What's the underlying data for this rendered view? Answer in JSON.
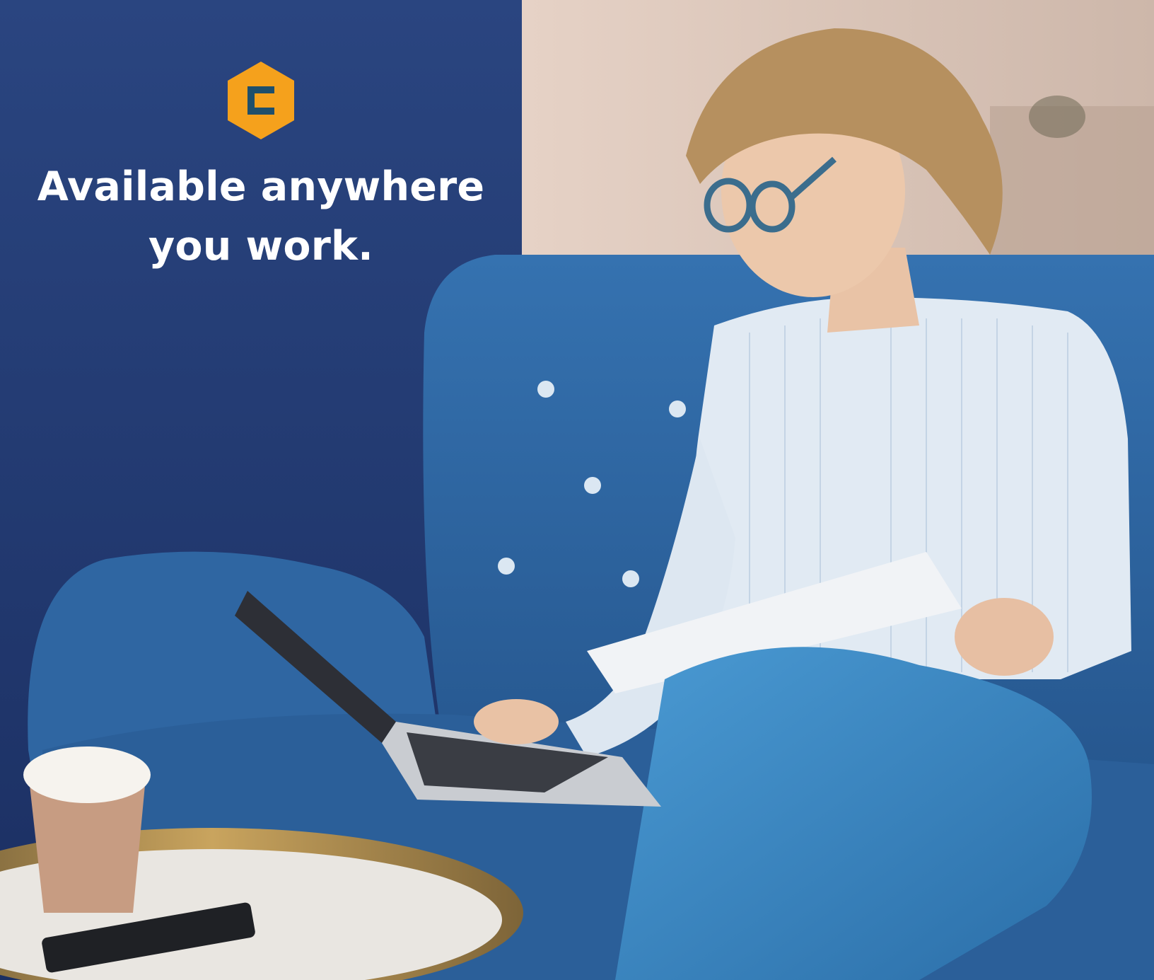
{
  "brand": {
    "logo_letter": "C",
    "logo_colors": {
      "hexagon": "#f5a11c",
      "letter": "#1f4f6b"
    }
  },
  "headline": {
    "line1": "Available anywhere",
    "line2": "you work."
  },
  "palette": {
    "wall": "#243f7a",
    "sofa": "#2f67a3",
    "shirt": "#dfe9f2",
    "pants": "#3a86c4",
    "warm_wall": "#e3cfc3"
  }
}
